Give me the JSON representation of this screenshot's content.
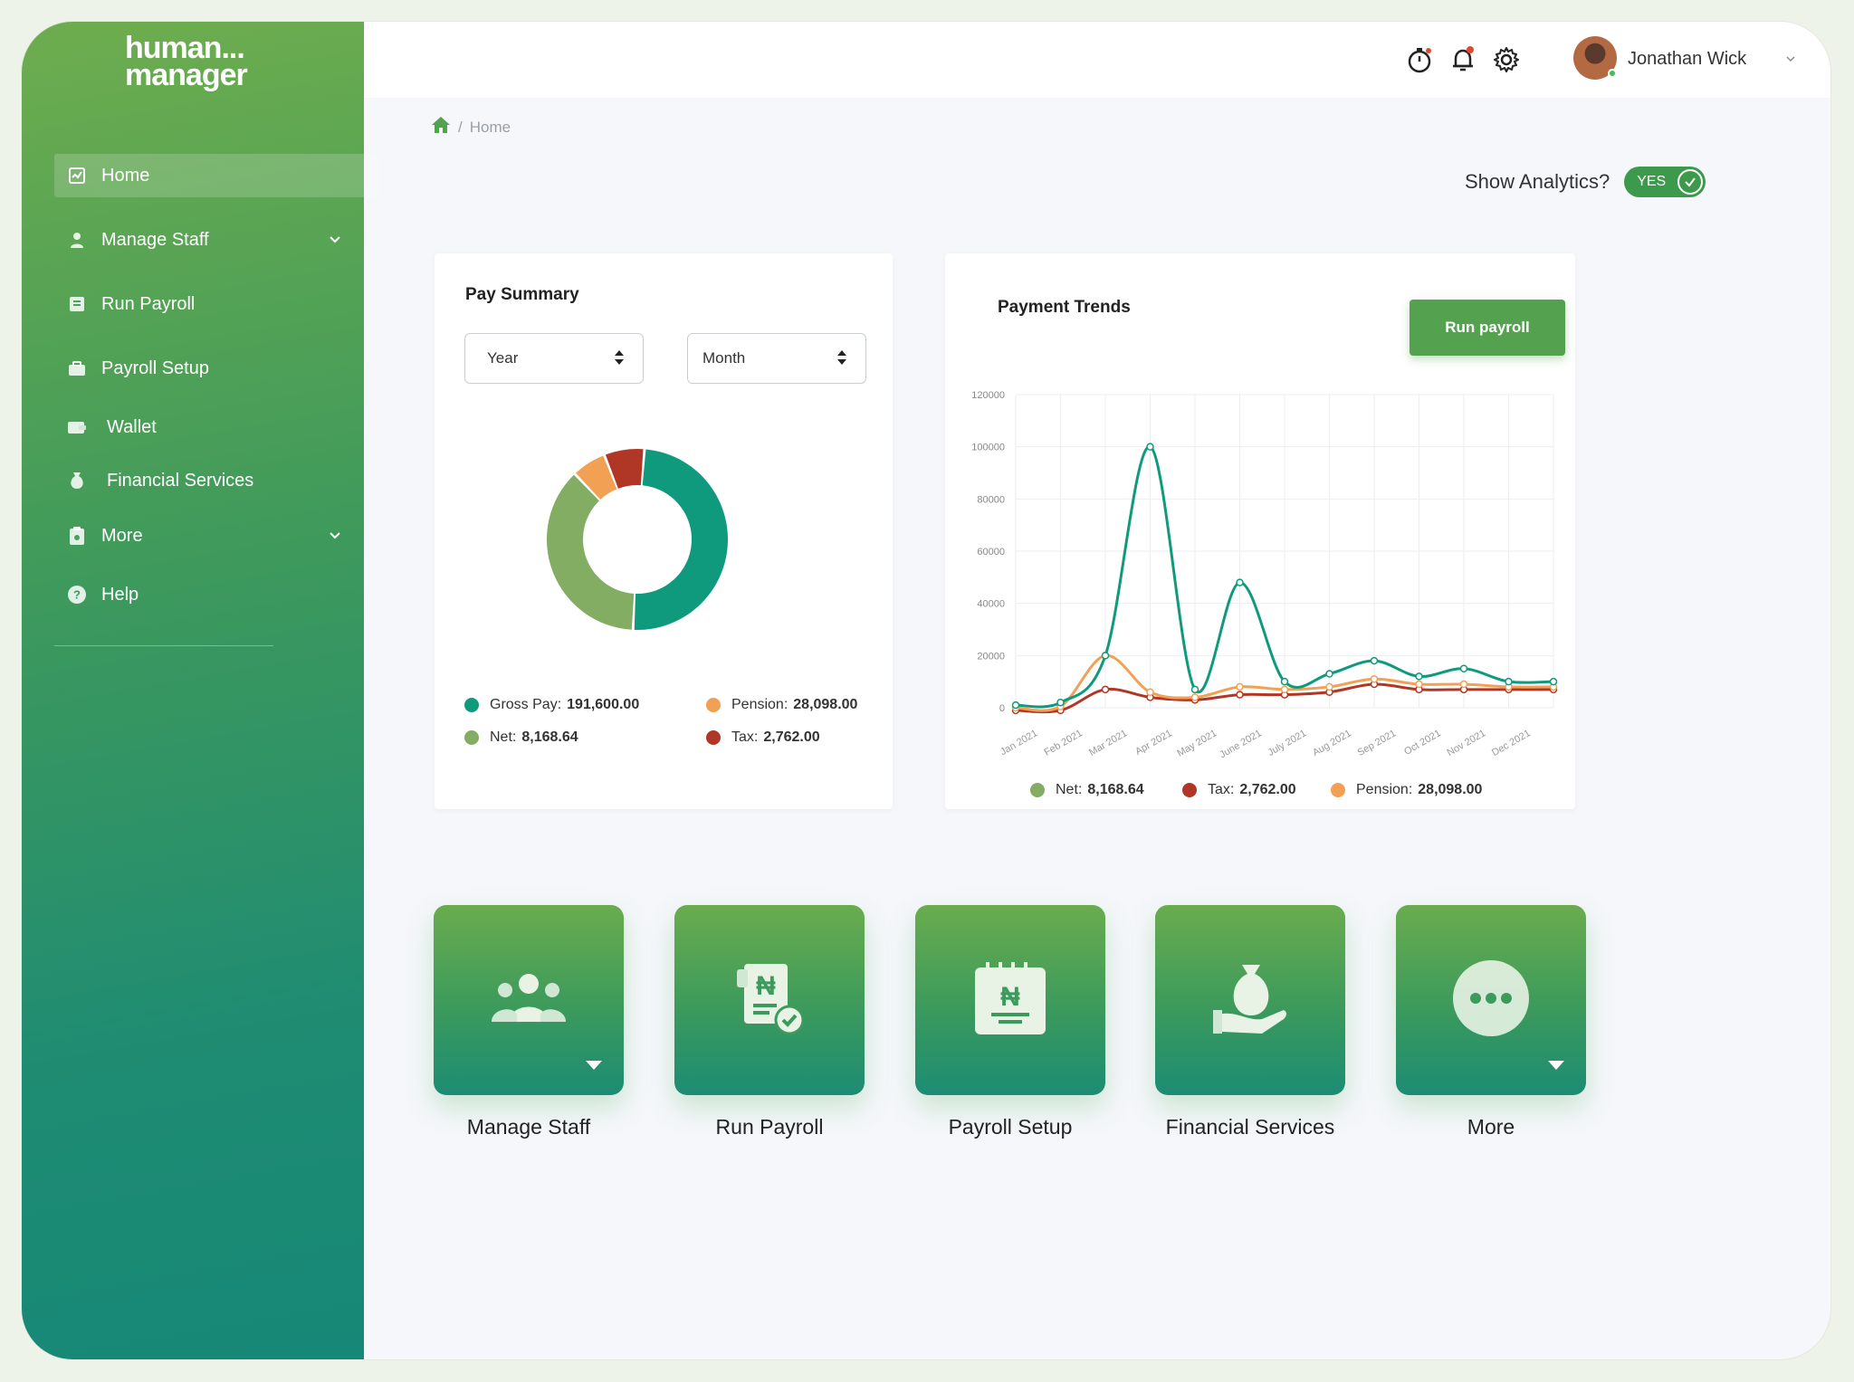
{
  "brand": {
    "line1": "human...",
    "line2": "manager"
  },
  "sidebar": {
    "items": [
      {
        "label": "Home",
        "icon": "home-chart-icon",
        "active": true
      },
      {
        "label": "Manage Staff",
        "icon": "user-icon",
        "expandable": true
      },
      {
        "label": "Run Payroll",
        "icon": "payroll-doc-icon"
      },
      {
        "label": "Payroll Setup",
        "icon": "briefcase-icon"
      },
      {
        "label": "Wallet",
        "icon": "wallet-icon"
      },
      {
        "label": "Financial Services",
        "icon": "money-bag-icon"
      },
      {
        "label": "More",
        "icon": "clipboard-icon",
        "expandable": true
      },
      {
        "label": "Help",
        "icon": "help-icon"
      }
    ]
  },
  "header": {
    "user_name": "Jonathan Wick"
  },
  "breadcrumb": {
    "current": "Home",
    "separator": "/"
  },
  "analytics": {
    "label": "Show Analytics?",
    "toggle_label": "YES",
    "enabled": true
  },
  "pay_summary": {
    "title": "Pay Summary",
    "year_select": "Year",
    "month_select": "Month",
    "legend": [
      {
        "label": "Gross Pay:",
        "value": "191,600.00",
        "color": "#0f9a7d"
      },
      {
        "label": "Pension:",
        "value": "28,098.00",
        "color": "#f2a154"
      },
      {
        "label": "Net:",
        "value": "8,168.64",
        "color": "#83ad62"
      },
      {
        "label": "Tax:",
        "value": "2,762.00",
        "color": "#b03726"
      }
    ]
  },
  "payment_trends": {
    "title": "Payment Trends",
    "run_button": "Run payroll",
    "legend": [
      {
        "label": "Net:",
        "value": "8,168.64",
        "color": "#83ad62"
      },
      {
        "label": "Tax:",
        "value": "2,762.00",
        "color": "#b03726"
      },
      {
        "label": "Pension:",
        "value": "28,098.00",
        "color": "#f2a154"
      }
    ]
  },
  "chart_data": [
    {
      "type": "pie",
      "title": "Pay Summary",
      "categories": [
        "Gross Pay",
        "Net",
        "Pension",
        "Tax"
      ],
      "values": [
        48,
        36,
        6,
        7
      ],
      "colors": [
        "#0f9a7d",
        "#83ad62",
        "#f2a154",
        "#b03726"
      ],
      "donut": true
    },
    {
      "type": "line",
      "title": "Payment Trends",
      "categories": [
        "Jan 2021",
        "Feb 2021",
        "Mar 2021",
        "Apr 2021",
        "May 2021",
        "June 2021",
        "July 2021",
        "Aug 2021",
        "Sep 2021",
        "Oct 2021",
        "Nov 2021",
        "Dec 2021"
      ],
      "ylim": [
        0,
        120000
      ],
      "yticks": [
        "0",
        "20000",
        "40000",
        "60000",
        "80000",
        "100000",
        "120000"
      ],
      "grid": true,
      "series": [
        {
          "name": "Gross Pay",
          "color": "#0f9a7d",
          "x": [
            0,
            1,
            2,
            3,
            4,
            5,
            6,
            7,
            8,
            9,
            10,
            11,
            12
          ],
          "values": [
            1000,
            2000,
            20000,
            100000,
            7000,
            48000,
            10000,
            13000,
            18000,
            12000,
            15000,
            10000,
            10000
          ]
        },
        {
          "name": "Pension",
          "color": "#f2a154",
          "x": [
            0,
            1,
            2,
            3,
            4,
            5,
            6,
            7,
            8,
            9,
            10,
            11,
            12
          ],
          "values": [
            0,
            500,
            20000,
            6000,
            4000,
            8000,
            7000,
            8000,
            11000,
            9000,
            9000,
            8000,
            8000
          ]
        },
        {
          "name": "Tax",
          "color": "#b03726",
          "x": [
            0,
            1,
            2,
            3,
            4,
            5,
            6,
            7,
            8,
            9,
            10,
            11,
            12
          ],
          "values": [
            -1000,
            -1000,
            7000,
            4000,
            3000,
            5000,
            5000,
            6000,
            9000,
            7000,
            7000,
            7000,
            7000
          ]
        }
      ]
    }
  ],
  "tiles": [
    {
      "label": "Manage Staff",
      "icon": "team-icon",
      "dropdown": true
    },
    {
      "label": "Run Payroll",
      "icon": "payroll-check-icon",
      "dropdown": false
    },
    {
      "label": "Payroll Setup",
      "icon": "calendar-naira-icon",
      "dropdown": false
    },
    {
      "label": "Financial Services",
      "icon": "hand-money-bag-icon",
      "dropdown": false
    },
    {
      "label": "More",
      "icon": "more-dots-icon",
      "dropdown": true
    }
  ]
}
